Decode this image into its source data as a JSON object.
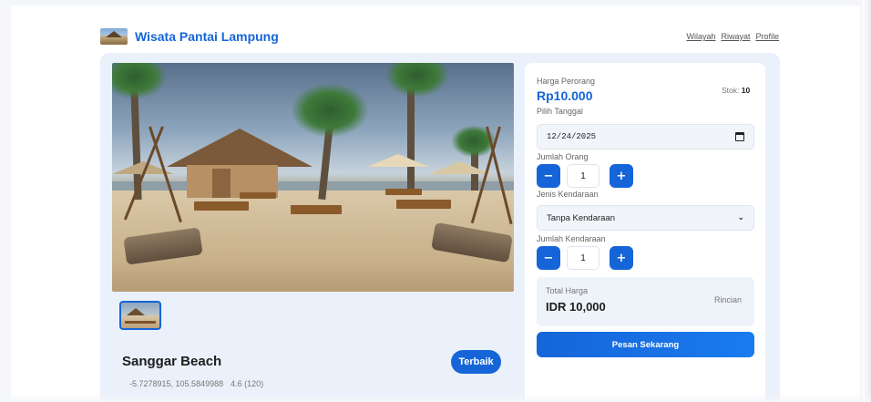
{
  "header": {
    "brand": "Wisata Pantai Lampung",
    "nav": [
      "Wilayah",
      "Riwayat",
      "Profile"
    ]
  },
  "beach": {
    "name": "Sanggar Beach",
    "badge": "Terbaik",
    "coordinates": "-5.7278915, 105.5849988",
    "rating": "4.6 (120)"
  },
  "booking": {
    "price_label": "Harga Perorang",
    "price": "Rp10.000",
    "stock_label": "Stok:",
    "stock_value": "10",
    "date_label": "Pilih Tanggal",
    "date_value": "12/24/2025",
    "people_label": "Jumlah Orang",
    "people_value": "1",
    "vehicle_type_label": "Jenis Kendaraan",
    "vehicle_type_value": "Tanpa Kendaraan",
    "vehicle_count_label": "Jumlah Kendaraan",
    "vehicle_count_value": "1",
    "minus": "−",
    "plus": "+",
    "total_label": "Total Harga",
    "total_value": "IDR 10,000",
    "details_link": "Rincian",
    "order_button": "Pesan Sekarang"
  },
  "icons": {
    "logo": "beach-hut-logo-icon",
    "calendar": "calendar-icon",
    "chevron": "chevron-down-icon",
    "thumbnail": "beach-photo-thumbnail"
  },
  "colors": {
    "accent": "#1565d8",
    "background": "#f4f6f9",
    "panel": "#eaf1fa"
  }
}
